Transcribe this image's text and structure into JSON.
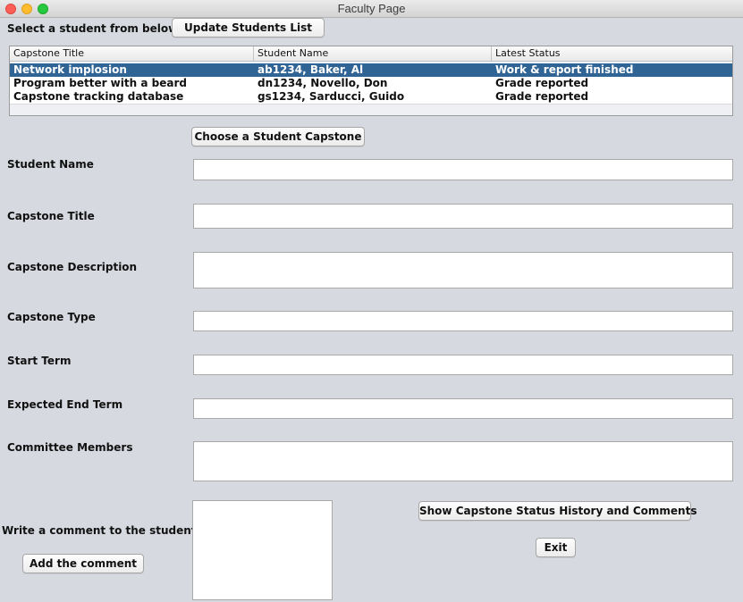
{
  "window": {
    "title": "Faculty Page"
  },
  "top": {
    "select_label": "Select a student from below:",
    "update_button": "Update Students List"
  },
  "table": {
    "columns": [
      "Capstone Title",
      "Student Name",
      "Latest Status"
    ],
    "rows": [
      [
        "Network implosion",
        "ab1234, Baker, Al",
        "Work & report finished"
      ],
      [
        "Program better with a beard",
        "dn1234, Novello, Don",
        "Grade reported"
      ],
      [
        "Capstone tracking database",
        "gs1234, Sarducci, Guido",
        "Grade reported"
      ]
    ],
    "selected_row": 0
  },
  "choose_button": "Choose a Student Capstone",
  "fields": {
    "student_name": {
      "label": "Student Name",
      "value": ""
    },
    "capstone_title": {
      "label": "Capstone Title",
      "value": ""
    },
    "capstone_description": {
      "label": "Capstone Description",
      "value": ""
    },
    "capstone_type": {
      "label": "Capstone Type",
      "value": ""
    },
    "start_term": {
      "label": "Start Term",
      "value": ""
    },
    "expected_end_term": {
      "label": "Expected End Term",
      "value": ""
    },
    "committee_members": {
      "label": "Committee Members",
      "value": ""
    }
  },
  "comment": {
    "label": "Write a comment to the student:",
    "value": "",
    "add_button": "Add the comment"
  },
  "history_button": "Show Capstone Status History and Comments",
  "exit_button": "Exit",
  "colors": {
    "background": "#d6d9df",
    "selection": "#2f6495"
  }
}
